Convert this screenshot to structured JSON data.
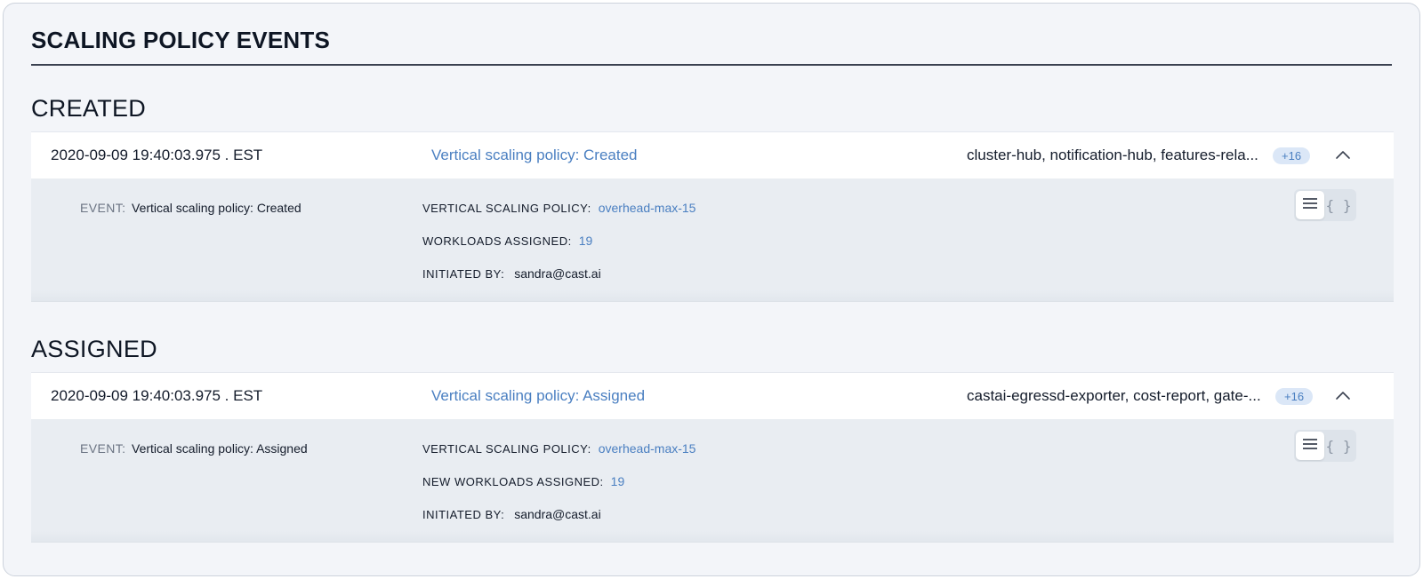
{
  "page_title": "SCALING POLICY EVENTS",
  "sections": [
    {
      "heading": "CREATED",
      "row": {
        "timestamp": "2020-09-09 19:40:03.975 . EST",
        "title": "Vertical scaling policy: Created",
        "resources": "cluster-hub, notification-hub, features-rela...",
        "badge": "+16"
      },
      "details": {
        "event_key": "EVENT:",
        "event_value": "Vertical scaling policy: Created",
        "policy_key": "VERTICAL SCALING POLICY:",
        "policy_value": "overhead-max-15",
        "workloads_key": "WORKLOADS ASSIGNED:",
        "workloads_value": "19",
        "initiated_key": "INITIATED BY:",
        "initiated_value": "sandra@cast.ai"
      }
    },
    {
      "heading": "ASSIGNED",
      "row": {
        "timestamp": "2020-09-09 19:40:03.975 . EST",
        "title": "Vertical scaling policy: Assigned",
        "resources": "castai-egressd-exporter, cost-report, gate-...",
        "badge": "+16"
      },
      "details": {
        "event_key": "EVENT:",
        "event_value": "Vertical scaling policy: Assigned",
        "policy_key": "VERTICAL SCALING POLICY:",
        "policy_value": "overhead-max-15",
        "workloads_key": "NEW WORKLOADS ASSIGNED:",
        "workloads_value": "19",
        "initiated_key": "INITIATED BY:",
        "initiated_value": "sandra@cast.ai"
      }
    }
  ],
  "icons": {
    "collapse": "chevron-up-icon",
    "list_view": "list-icon",
    "json_view": "braces-icon"
  },
  "colors": {
    "link": "#4a7fc1",
    "badge_bg": "#dbe7f7",
    "panel_bg": "#f3f5f9",
    "details_bg": "#e9edf2"
  }
}
